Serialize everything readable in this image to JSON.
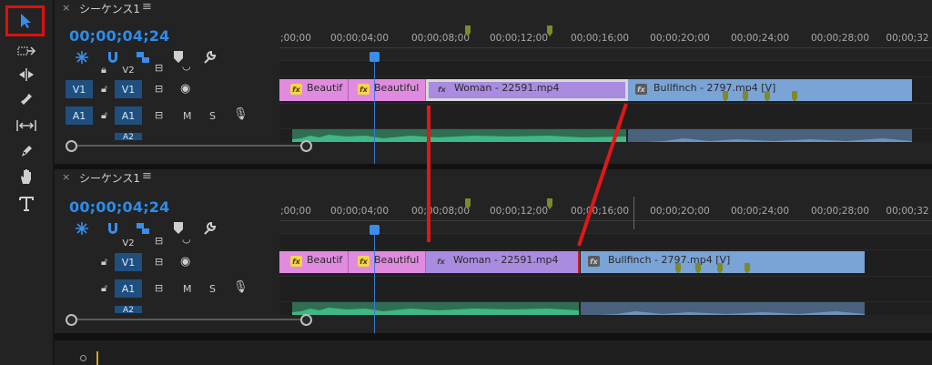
{
  "toolbar": {
    "tools": [
      "selection",
      "track-select-forward",
      "ripple-edit",
      "razor",
      "slip",
      "pen",
      "hand",
      "type"
    ]
  },
  "panels": [
    {
      "tab_close": "×",
      "tab_title": "シーケンス1",
      "tab_menu": "≡",
      "timecode": "00;00;04;24",
      "ruler_labels": [
        ";00;00",
        "00;00;04;00",
        "00;00;08;00",
        "00;00;12;00",
        "00;00;16;00",
        "00;00;2O;00",
        "00;00;24;00",
        "00;00;28;00",
        "00;00;32"
      ],
      "tracks": {
        "v2": "V2",
        "v1_source": "V1",
        "v1": "V1",
        "a1_source": "A1",
        "a1": "A1",
        "a2": "A2",
        "mute": "M",
        "solo": "S"
      },
      "clips": [
        {
          "label": "Beautif",
          "color": "pink"
        },
        {
          "label": "Beautiful",
          "color": "pink"
        },
        {
          "label": "Woman - 22591.mp4",
          "color": "purple"
        },
        {
          "label": "Bullfinch - 2797.mp4 [V]",
          "color": "blue"
        }
      ],
      "fx_label": "fx"
    },
    {
      "tab_close": "×",
      "tab_title": "シーケンス1",
      "tab_menu": "≡",
      "timecode": "00;00;04;24",
      "ruler_labels": [
        ";00;00",
        "00;00;04;00",
        "00;00;08;00",
        "00;00;12;00",
        "00;00;16;00",
        "00;00;2O;00",
        "00;00;24;00",
        "00;00;28;00",
        "00;00;32"
      ],
      "tracks": {
        "v2": "V2",
        "v1_source": "",
        "v1": "V1",
        "a1_source": "",
        "a1": "A1",
        "a2": "A2",
        "mute": "M",
        "solo": "S"
      },
      "clips": [
        {
          "label": "Beautif",
          "color": "pink"
        },
        {
          "label": "Beautiful",
          "color": "pink"
        },
        {
          "label": "Woman - 22591.mp4",
          "color": "purple"
        },
        {
          "label": "Bullfinch - 2797.mp4 [V]",
          "color": "blue"
        }
      ],
      "fx_label": "fx"
    }
  ],
  "colors": {
    "timecode": "#2d8ceb",
    "annotation_red": "#e01818",
    "clip_pink": "#e08be0",
    "clip_purple": "#a98be0",
    "clip_blue": "#7aa3d6",
    "audio_green": "#2f6e52",
    "audio_blue": "#4a627e"
  }
}
